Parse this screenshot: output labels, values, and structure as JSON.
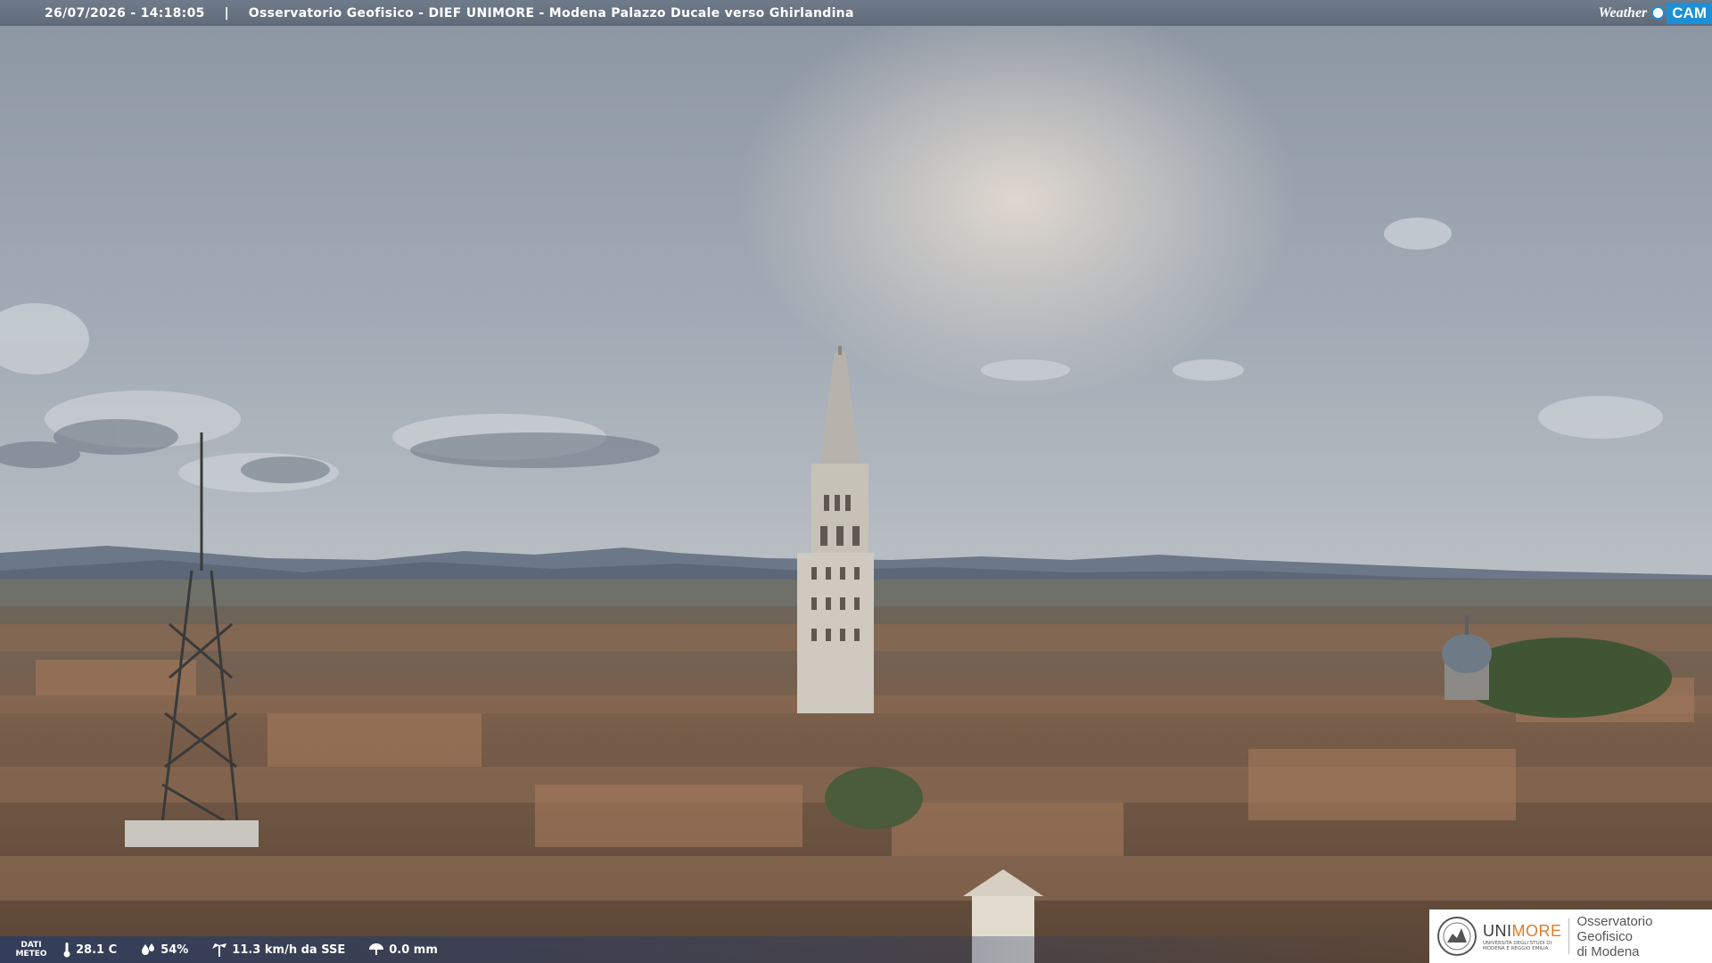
{
  "header": {
    "timestamp": "26/07/2026 - 14:18:05",
    "separator": "|",
    "location": "Osservatorio Geofisico - DIEF UNIMORE - Modena Palazzo Ducale verso Ghirlandina"
  },
  "brand": {
    "weather": "Weather",
    "cam": "CAM"
  },
  "meteo": {
    "label_line1": "DATI",
    "label_line2": "METEO",
    "temperature": "28.1 C",
    "humidity": "54%",
    "wind": "11.3 km/h da SSE",
    "rain": "0.0 mm"
  },
  "institution": {
    "uni": "UNI",
    "more": "MORE",
    "subtitle_line1": "UNIVERSITÀ DEGLI STUDI DI",
    "subtitle_line2": "MODENA E REGGIO EMILIA",
    "observatory_line1": "Osservatorio Geofisico",
    "observatory_line2": "di Modena"
  },
  "colors": {
    "accent": "#1d8fd6",
    "unimore_orange": "#e07b28"
  }
}
